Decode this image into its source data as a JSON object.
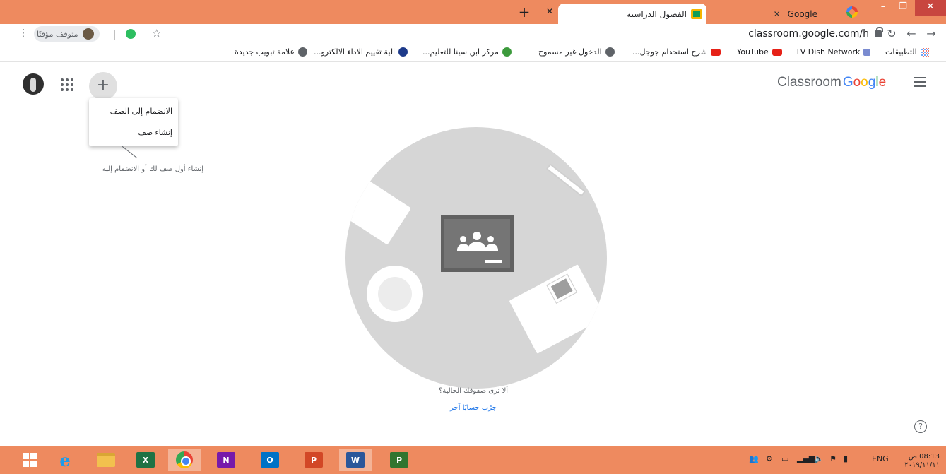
{
  "browser": {
    "tabs": [
      {
        "title": "Google",
        "favicon": "google-icon",
        "active": false
      },
      {
        "title": "الفصول الدراسية",
        "favicon": "classroom-icon",
        "active": true
      }
    ],
    "new_tab_symbol": "+",
    "close_symbol": "✕",
    "window_buttons": {
      "minimize": "–",
      "maximize": "❐",
      "close": "✕"
    },
    "url": "classroom.google.com/h",
    "profile_status": "متوقف مؤقتًا",
    "menu_symbol": "⋮",
    "back_symbol": "→",
    "forward_symbol": "←",
    "reload_symbol": "↻",
    "star_symbol": "☆"
  },
  "bookmarks": [
    {
      "label": "التطبيقات",
      "icon": "apps-grid-icon"
    },
    {
      "label": "TV Dish Network",
      "icon": "tv-icon"
    },
    {
      "label": "YouTube",
      "icon": "youtube-icon"
    },
    {
      "label": "شرح استخدام جوجل...",
      "icon": "youtube-icon"
    },
    {
      "label": "الدخول غير مسموح",
      "icon": "globe-icon"
    },
    {
      "label": "مركز ابن سينا للتعليم...",
      "icon": "leaf-icon"
    },
    {
      "label": "الية تقييم الاداء الالكترو...",
      "icon": "owl-icon"
    },
    {
      "label": "علامة تبويب جديدة",
      "icon": "globe-icon"
    }
  ],
  "classroom": {
    "brand_word": "Classroom",
    "brand_google": [
      "G",
      "o",
      "o",
      "g",
      "l",
      "e"
    ],
    "add_symbol": "+",
    "menu": {
      "join_class": "الانضمام إلى الصف",
      "create_class": "إنشاء صف"
    },
    "hint": "إنشاء أول صف لك أو الانضمام إليه",
    "empty_question": "ألا ترى صفوفك الحالية؟",
    "try_other_account": "جرّب حسابًا آخر",
    "help_symbol": "?"
  },
  "taskbar": {
    "apps": [
      {
        "name": "start",
        "icon": "windows-logo-icon"
      },
      {
        "name": "internet-explorer",
        "label": "e"
      },
      {
        "name": "file-explorer",
        "icon": "folder-icon"
      },
      {
        "name": "excel",
        "label": "X"
      },
      {
        "name": "chrome",
        "icon": "chrome-icon",
        "active": true
      },
      {
        "name": "onenote",
        "label": "N"
      },
      {
        "name": "outlook",
        "label": "O"
      },
      {
        "name": "powerpoint",
        "label": "P"
      },
      {
        "name": "word",
        "label": "W",
        "active": true
      },
      {
        "name": "project",
        "label": "P"
      }
    ],
    "language": "ENG",
    "time": "08:13 ص",
    "date": "٢٠١٩/١١/١١"
  },
  "colors": {
    "chrome_frame": "#ee8a5f",
    "taskbar": "#ee8a5f",
    "illustration_bg": "#d6d6d6",
    "link": "#1a73e8",
    "excel": "#1f7244",
    "onenote": "#7719aa",
    "outlook": "#0072c6",
    "powerpoint": "#d24726",
    "word": "#2b579a",
    "project": "#31752f"
  }
}
